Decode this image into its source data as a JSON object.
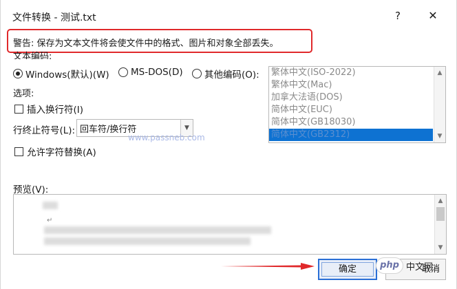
{
  "window": {
    "title": "文件转换 - 测试.txt",
    "help_label": "?",
    "close_label": "✕"
  },
  "warning": {
    "text": "警告: 保存为文本文件将会使文件中的格式、图片和对象全部丢失。",
    "highlight_color": "#e0282a"
  },
  "encoding": {
    "label": "文本编码:",
    "radios": [
      {
        "label": "Windows(默认)(W)",
        "selected": true
      },
      {
        "label": "MS-DOS(D)",
        "selected": false
      },
      {
        "label": "其他编码(O):",
        "selected": false
      }
    ],
    "list": [
      {
        "label": "繁体中文(ISO-2022)",
        "selected": false
      },
      {
        "label": "繁体中文(Mac)",
        "selected": false
      },
      {
        "label": "加拿大法语(DOS)",
        "selected": false
      },
      {
        "label": "简体中文(EUC)",
        "selected": false
      },
      {
        "label": "简体中文(GB18030)",
        "selected": false
      },
      {
        "label": "简体中文(GB2312)",
        "selected": true
      }
    ],
    "selection_color": "#0e72d2"
  },
  "options": {
    "label": "选项:",
    "insert_linebreak": {
      "label": "插入换行符(I)",
      "checked": false
    },
    "line_ending": {
      "label": "行终止符号(L):",
      "value": "回车符/换行符"
    },
    "allow_substitution": {
      "label": "允许字符替换(A)",
      "checked": false
    }
  },
  "watermark": "www.passneb.com",
  "preview": {
    "label": "预览(V):",
    "line_marker": "↵"
  },
  "buttons": {
    "ok_label": "确定",
    "cancel_label": "取消",
    "ok_border_color": "#2a6fd6"
  },
  "overlay": {
    "php_logo": "php",
    "site_label": "中文网",
    "arrow_color": "#e0282a"
  }
}
